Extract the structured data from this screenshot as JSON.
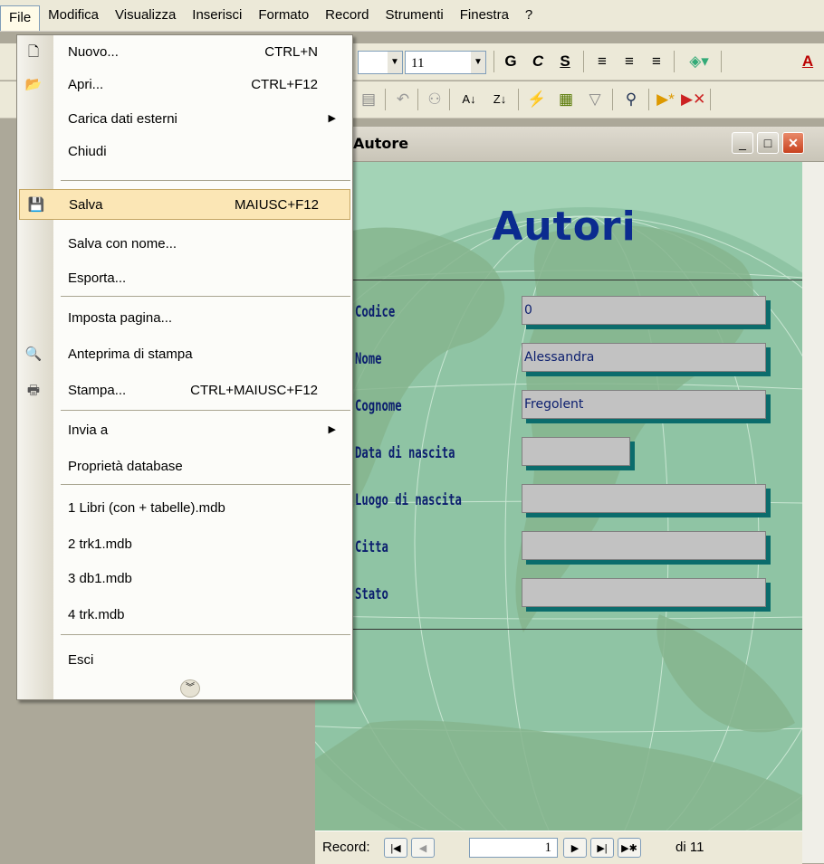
{
  "menubar": [
    "File",
    "Modifica",
    "Visualizza",
    "Inserisci",
    "Formato",
    "Record",
    "Strumenti",
    "Finestra",
    "?"
  ],
  "toolbar": {
    "font_size": "11",
    "bold": "G",
    "italic": "C",
    "underline": "S"
  },
  "file_menu": {
    "items": [
      {
        "label": "Nuovo...",
        "shortcut": "CTRL+N",
        "icon": "new-doc-icon"
      },
      {
        "label": "Apri...",
        "shortcut": "CTRL+F12",
        "icon": "open-folder-icon"
      },
      {
        "label": "Carica dati esterni",
        "submenu": true
      },
      {
        "label": "Chiudi"
      },
      {
        "label": "Salva",
        "shortcut": "MAIUSC+F12",
        "icon": "save-disk-icon",
        "selected": true
      },
      {
        "label": "Salva con nome..."
      },
      {
        "label": "Esporta..."
      },
      {
        "label": "Imposta pagina..."
      },
      {
        "label": "Anteprima di stampa",
        "icon": "print-preview-icon"
      },
      {
        "label": "Stampa...",
        "shortcut": "CTRL+MAIUSC+F12",
        "icon": "printer-icon"
      },
      {
        "label": "Invia a",
        "submenu": true
      },
      {
        "label": "Proprietà database"
      },
      {
        "label": "1 Libri (con + tabelle).mdb"
      },
      {
        "label": "2 trk1.mdb"
      },
      {
        "label": "3 db1.mdb"
      },
      {
        "label": "4 trk.mdb"
      },
      {
        "label": "Esci"
      }
    ]
  },
  "form_window": {
    "title": "Autore",
    "heading": "Autori",
    "fields": [
      {
        "label": "Codice",
        "value": "0"
      },
      {
        "label": "Nome",
        "value": "Alessandra"
      },
      {
        "label": "Cognome",
        "value": "Fregolent"
      },
      {
        "label": "Data di nascita",
        "value": ""
      },
      {
        "label": "Luogo di nascita",
        "value": ""
      },
      {
        "label": "Citta",
        "value": ""
      },
      {
        "label": "Stato",
        "value": ""
      }
    ]
  },
  "record_nav": {
    "label": "Record:",
    "current": "1",
    "total": "di 11"
  },
  "colors": {
    "menu_highlight": "#fbe6b5",
    "form_heading": "#0b2b8f",
    "field_shadow": "#0b6c6c"
  }
}
